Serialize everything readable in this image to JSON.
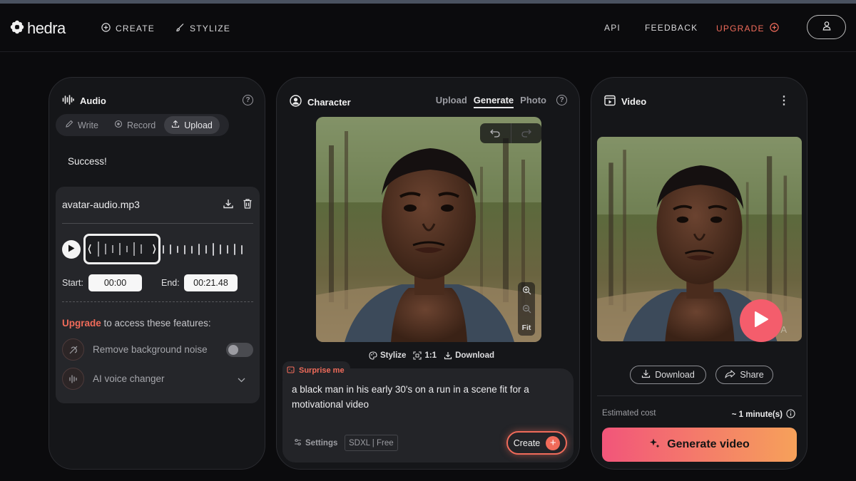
{
  "brand": {
    "name": "hedra",
    "icon": "flower-icon"
  },
  "nav": {
    "create": "CREATE",
    "stylize": "STYLIZE",
    "api": "API",
    "feedback": "FEEDBACK",
    "upgrade": "UPGRADE",
    "accent": "#f06b5a"
  },
  "audio": {
    "title": "Audio",
    "tabs": {
      "write": "Write",
      "record": "Record",
      "upload": "Upload",
      "active": "Upload"
    },
    "status": "Success!",
    "file": {
      "name": "avatar-audio.mp3"
    },
    "start_label": "Start:",
    "start_value": "00:00",
    "end_label": "End:",
    "end_value": "00:21.48",
    "upgrade_word": "Upgrade",
    "upgrade_rest": " to access these features:",
    "features": {
      "noise": "Remove background noise",
      "voice": "AI voice changer"
    },
    "noise_enabled": false
  },
  "character": {
    "title": "Character",
    "tabs": {
      "upload": "Upload",
      "generate": "Generate",
      "photo": "Photo",
      "active": "Generate"
    },
    "zoom_fit": "Fit",
    "actions": {
      "stylize": "Stylize",
      "ratio": "1:1",
      "download": "Download"
    },
    "surprise": "Surprise me",
    "prompt": "a black man in his early 30's on a run in a scene fit for a motivational video",
    "settings": "Settings",
    "model": "SDXL | Free",
    "create": "Create"
  },
  "video": {
    "title": "Video",
    "watermark": "RA",
    "download": "Download",
    "share": "Share",
    "cost_label": "Estimated cost",
    "cost_value": "~ 1 minute(s)",
    "generate": "Generate video"
  }
}
